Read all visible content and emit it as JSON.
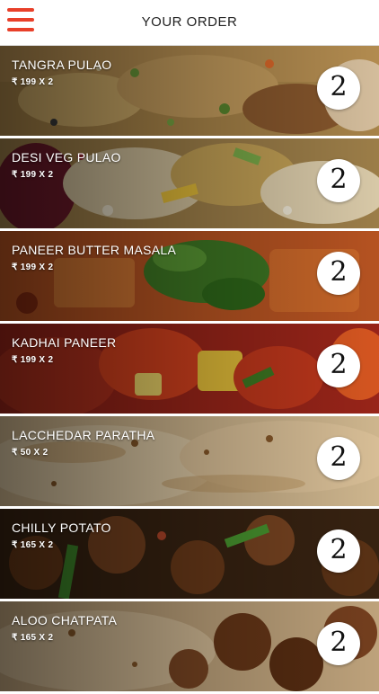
{
  "header": {
    "title": "YOUR ORDER",
    "menu_icon": "hamburger-menu-icon",
    "accent_color": "#e8402a"
  },
  "order_items": [
    {
      "name": "TANGRA PULAO",
      "price_line": "₹ 199 X 2",
      "quantity": "2"
    },
    {
      "name": "DESI VEG PULAO",
      "price_line": "₹ 199 X 2",
      "quantity": "2"
    },
    {
      "name": "PANEER BUTTER MASALA",
      "price_line": "₹ 199 X 2",
      "quantity": "2"
    },
    {
      "name": "KADHAI PANEER",
      "price_line": "₹ 199 X 2",
      "quantity": "2"
    },
    {
      "name": "LACCHEDAR PARATHA",
      "price_line": "₹ 50 X 2",
      "quantity": "2"
    },
    {
      "name": "CHILLY POTATO",
      "price_line": "₹ 165 X 2",
      "quantity": "2"
    },
    {
      "name": "ALOO CHATPATA",
      "price_line": "₹ 165 X 2",
      "quantity": "2"
    }
  ]
}
